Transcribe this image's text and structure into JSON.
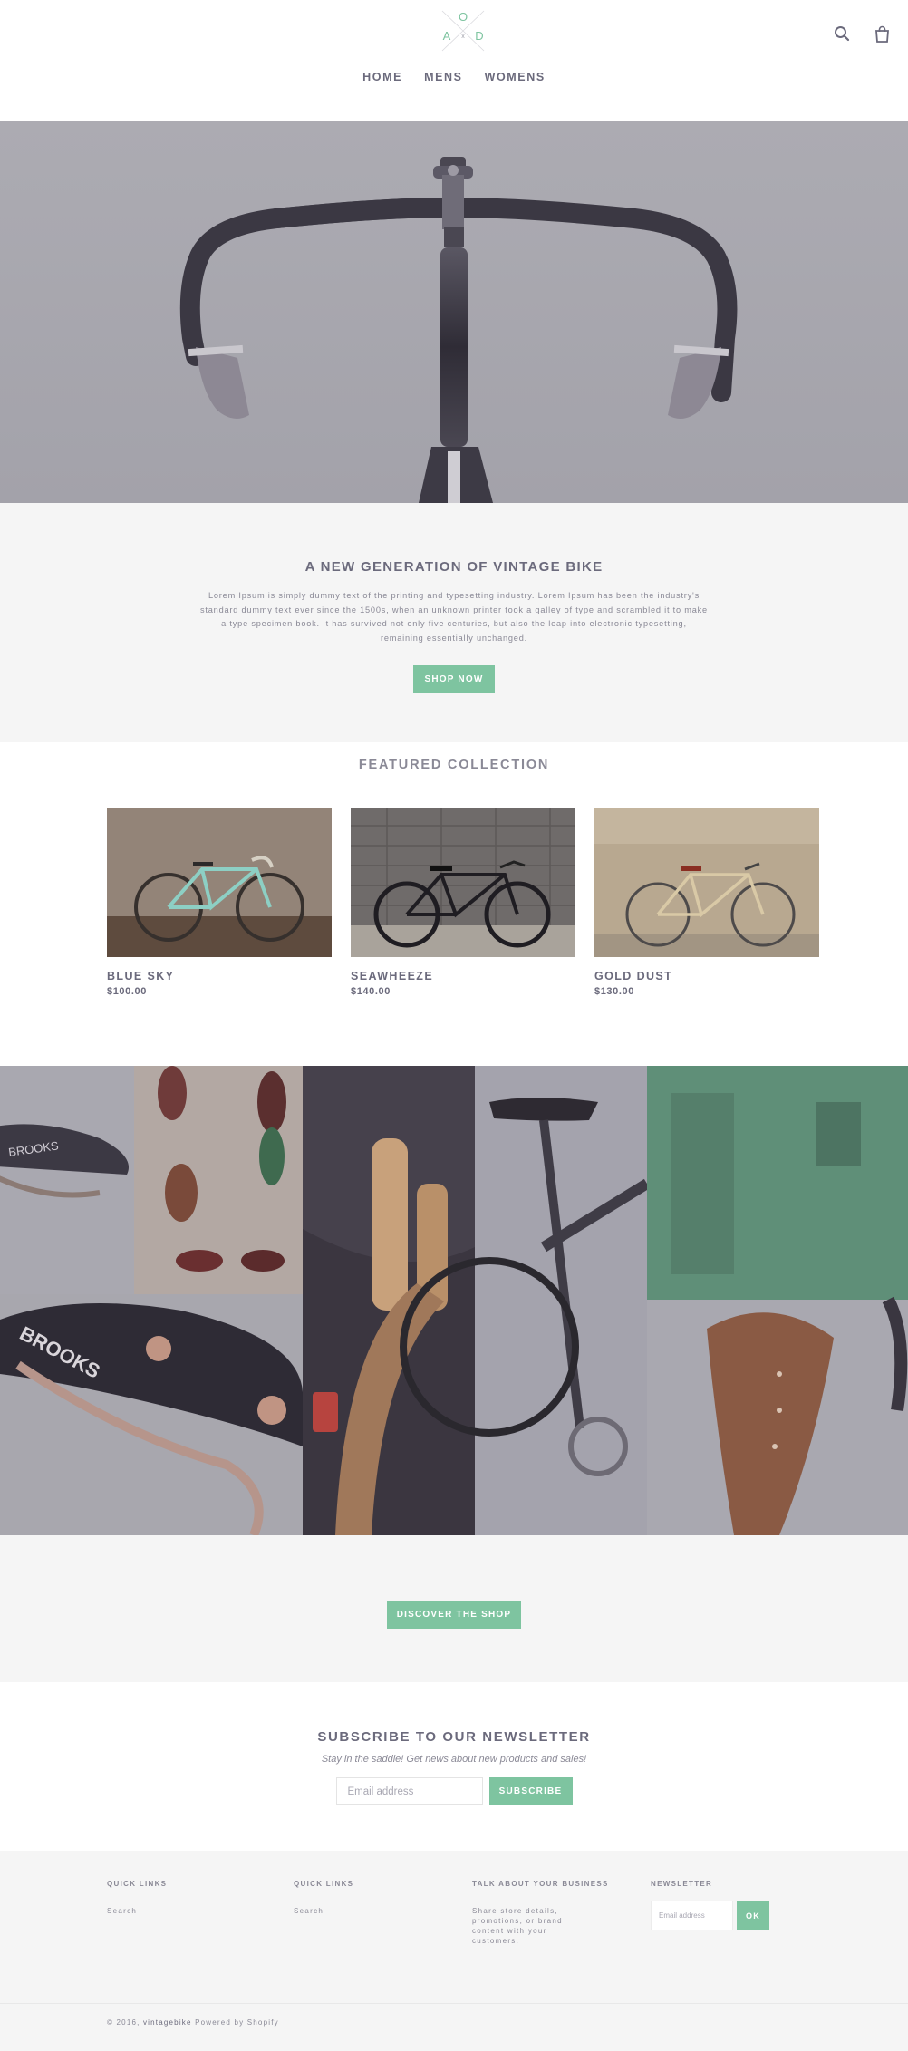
{
  "header": {
    "logo_letters": {
      "top": "O",
      "left": "A",
      "right": "D",
      "center": "x"
    },
    "nav": [
      {
        "label": "HOME"
      },
      {
        "label": "MENS"
      },
      {
        "label": "WOMENS"
      }
    ],
    "icons": {
      "search": "search-icon",
      "cart": "shopping-bag-icon"
    }
  },
  "intro": {
    "title": "A NEW GENERATION OF VINTAGE BIKE",
    "body": "Lorem Ipsum is simply dummy text of the printing and typesetting industry. Lorem Ipsum has been the industry's standard dummy text ever since the 1500s, when an unknown printer took a galley of type and scrambled it to make a type specimen book. It has survived not only five centuries, but also the leap into electronic typesetting, remaining essentially unchanged.",
    "button": "SHOP NOW"
  },
  "featured": {
    "title": "FEATURED COLLECTION",
    "products": [
      {
        "name": "BLUE SKY",
        "price": "$100.00"
      },
      {
        "name": "SEAWHEEZE",
        "price": "$140.00"
      },
      {
        "name": "GOLD DUST",
        "price": "$130.00"
      }
    ]
  },
  "collage": {
    "saddle_text": "BROOKS",
    "saddle_text_small": "BROOKS"
  },
  "discover": {
    "button": "DISCOVER THE SHOP"
  },
  "newsletter": {
    "title": "SUBSCRIBE TO OUR NEWSLETTER",
    "subtitle": "Stay in the saddle!  Get news about new products and sales!",
    "placeholder": "Email address",
    "button": "SUBSCRIBE"
  },
  "footer": {
    "col1": {
      "heading": "QUICK LINKS",
      "link": "Search"
    },
    "col2": {
      "heading": "QUICK LINKS",
      "link": "Search"
    },
    "col3": {
      "heading": "TALK ABOUT YOUR BUSINESS",
      "text": "Share store details, promotions, or brand content with your customers."
    },
    "col4": {
      "heading": "NEWSLETTER",
      "placeholder": "Email address",
      "button": "OK"
    },
    "copyright_prefix": "© 2016, ",
    "store_name": "vintagebike",
    "powered": " Powered by Shopify"
  },
  "colors": {
    "accent": "#7ec4a0",
    "text": "#6b6a7c",
    "panel": "#f5f5f5"
  }
}
